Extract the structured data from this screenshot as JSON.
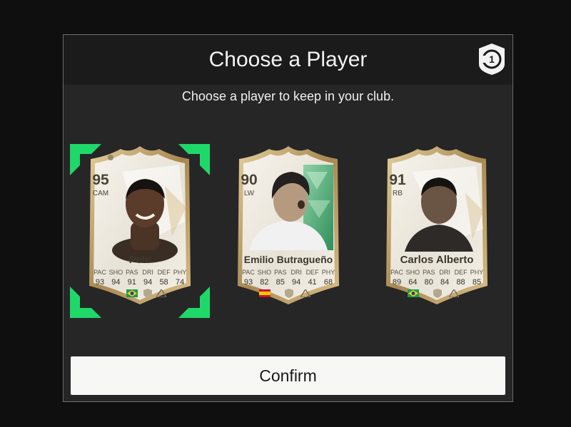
{
  "dialog": {
    "title": "Choose a Player",
    "subtitle": "Choose a player to keep in your club.",
    "badge_icon": "choice-badge-icon",
    "confirm_label": "Confirm"
  },
  "stat_labels": [
    "PAC",
    "SHO",
    "PAS",
    "DRI",
    "DEF",
    "PHY"
  ],
  "players": [
    {
      "name": "Pelé",
      "rating": "95",
      "position": "CAM",
      "stats": [
        "93",
        "94",
        "91",
        "94",
        "58",
        "74"
      ],
      "nation_flag": "brazil-flag-icon",
      "selected": true,
      "card_theme": "white-gold"
    },
    {
      "name": "Emilio Butragueño",
      "rating": "90",
      "position": "LW",
      "stats": [
        "93",
        "82",
        "85",
        "94",
        "41",
        "68"
      ],
      "nation_flag": "spain-flag-icon",
      "selected": false,
      "card_theme": "white-green"
    },
    {
      "name": "Carlos Alberto",
      "rating": "91",
      "position": "RB",
      "stats": [
        "89",
        "64",
        "80",
        "84",
        "88",
        "85"
      ],
      "nation_flag": "brazil-flag-icon",
      "selected": false,
      "card_theme": "white-gold"
    }
  ],
  "colors": {
    "selection_accent": "#1fd86a",
    "card_gold": "#b79a5e",
    "card_cream": "#f1ede4",
    "confirm_bg": "#f7f7f5"
  }
}
